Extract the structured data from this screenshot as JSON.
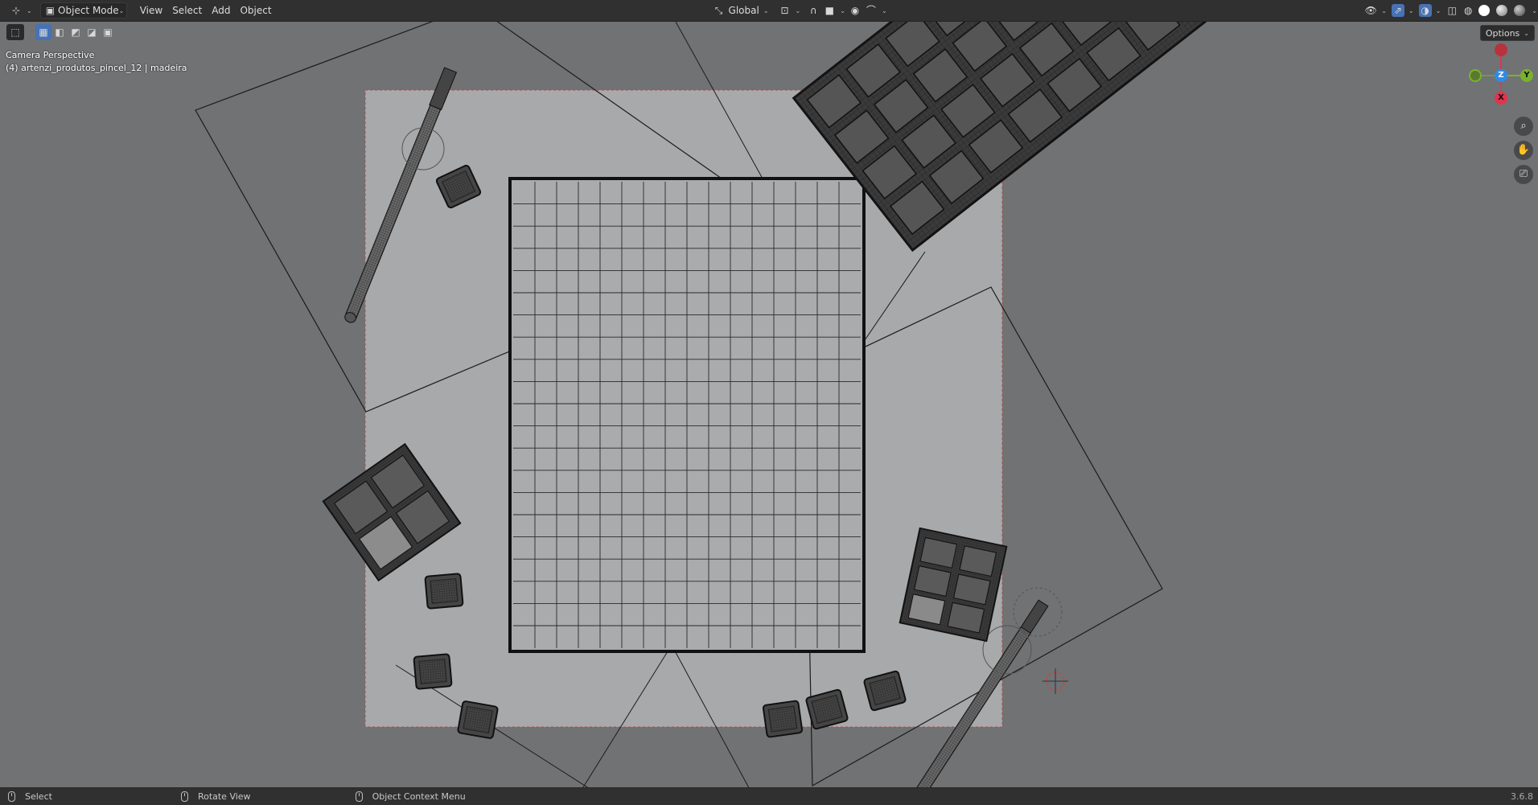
{
  "header": {
    "mode_label": "Object Mode",
    "menus": [
      "View",
      "Select",
      "Add",
      "Object"
    ],
    "orientation_label": "Global",
    "icons": {
      "editor_type": "editor-type-icon",
      "mode": "object-mode-icon",
      "orientation": "transform-orientation-icon",
      "pivot": "pivot-point-icon",
      "snap": "snap-magnet-icon",
      "proportional": "proportional-editing-icon",
      "visibility": "object-visibility-icon",
      "gizmo": "gizmo-toggle-icon",
      "overlays": "overlays-icon",
      "xray": "xray-toggle-icon",
      "shading_wireframe": "wireframe-shading-icon",
      "shading_solid": "solid-shading-icon",
      "shading_material": "material-preview-icon",
      "shading_rendered": "rendered-shading-icon"
    }
  },
  "toolbar": {
    "options_label": "Options",
    "select_modes": [
      "select-box-icon",
      "select-new-icon",
      "select-extend-icon",
      "select-subtract-icon",
      "select-invert-icon",
      "select-intersect-icon"
    ]
  },
  "viewport": {
    "view_name": "Camera Perspective",
    "object_info": "(4) artenzi_produtos_pincel_12 | madeira",
    "gizmo": {
      "z_label": "Z",
      "y_label": "Y",
      "x_label": "X",
      "colors": {
        "x": "#e2344d",
        "y": "#79b22c",
        "z": "#2f8ae8"
      }
    },
    "nav_buttons": [
      "zoom-icon",
      "pan-hand-icon",
      "camera-view-icon"
    ]
  },
  "statusbar": {
    "items": [
      "Select",
      "Rotate View",
      "Object Context Menu"
    ],
    "version": "3.6.8"
  }
}
